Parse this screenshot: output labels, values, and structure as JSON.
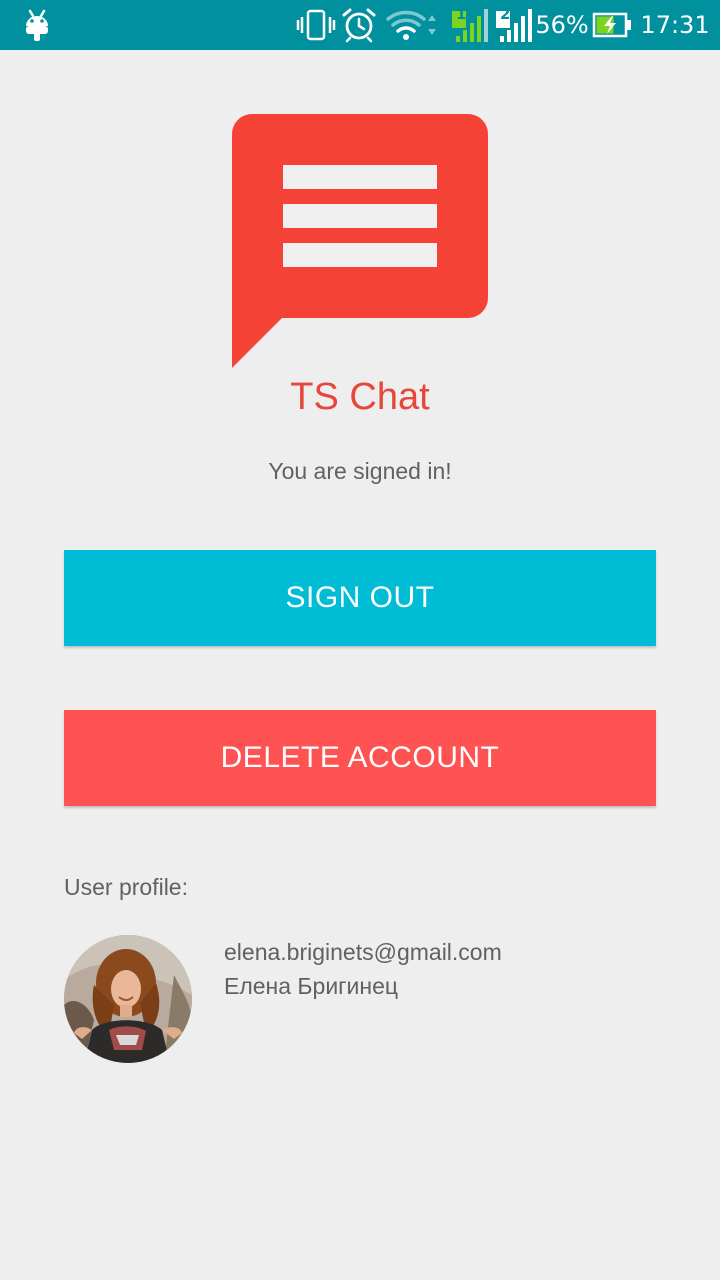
{
  "status_bar": {
    "battery_percent": "56%",
    "time": "17:31",
    "sim1_label": "1",
    "sim2_label": "2",
    "icons": [
      "android-debug-icon",
      "vibrate-icon",
      "alarm-icon",
      "wifi-icon",
      "signal-sim1-icon",
      "signal-sim2-icon",
      "battery-charging-icon"
    ]
  },
  "app": {
    "title": "TS Chat",
    "logo_icon": "chat-bubble-icon",
    "brand_color": "#e8463a"
  },
  "main": {
    "signed_in_text": "You are signed in!",
    "sign_out_label": "SIGN OUT",
    "delete_account_label": "DELETE ACCOUNT",
    "sign_out_color": "#00bcd4",
    "delete_color": "#ff5252"
  },
  "profile": {
    "label": "User profile:",
    "email": "elena.briginets@gmail.com",
    "name": "Елена Бригинец",
    "avatar_icon": "user-avatar"
  }
}
